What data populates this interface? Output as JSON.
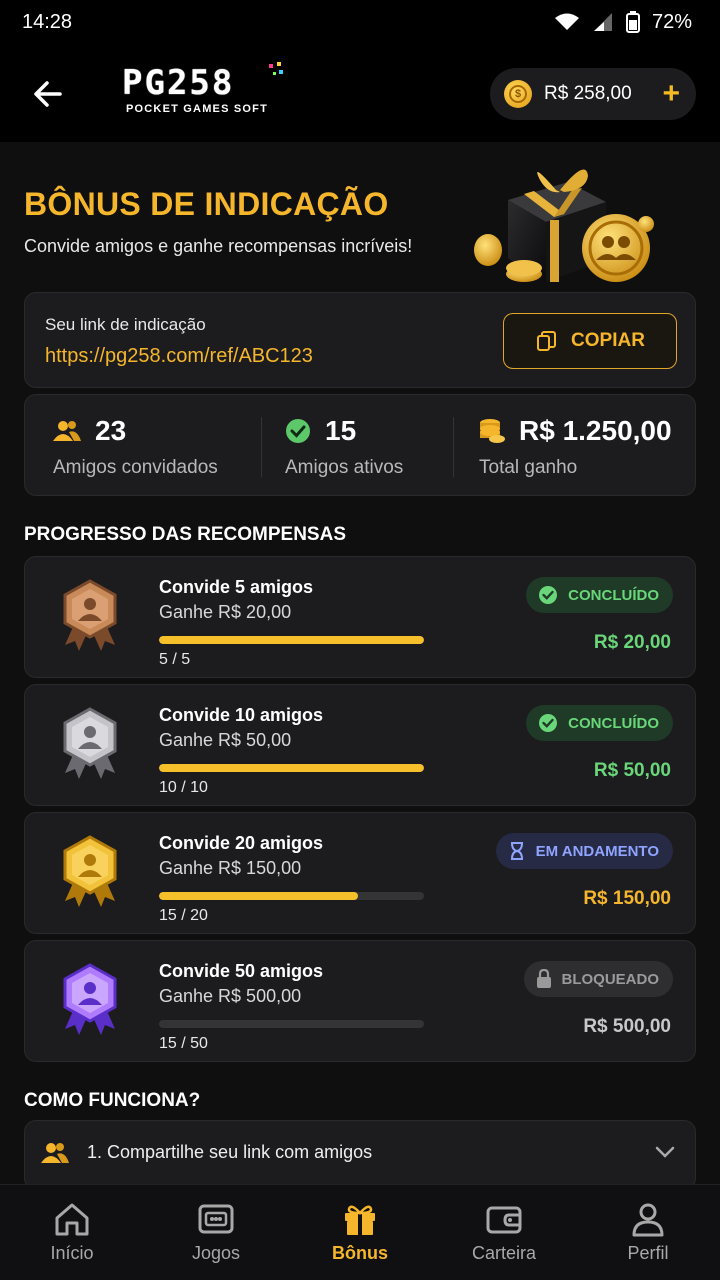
{
  "status_bar": {
    "time": "14:28",
    "battery": "72%"
  },
  "header": {
    "logo_main": "PG258",
    "logo_sub": "POCKET GAMES SOFT",
    "balance": "R$ 258,00"
  },
  "hero": {
    "title": "BÔNUS DE INDICAÇÃO",
    "subtitle": "Convide amigos e ganhe recompensas incríveis!"
  },
  "referral": {
    "label": "Seu link de indicação",
    "url": "https://pg258.com/ref/ABC123",
    "copy_label": "COPIAR"
  },
  "stats": [
    {
      "value": "23",
      "label": "Amigos convidados",
      "icon": "users-icon"
    },
    {
      "value": "15",
      "label": "Amigos ativos",
      "icon": "check-circle-icon"
    },
    {
      "value": "R$ 1.250,00",
      "label": "Total ganho",
      "icon": "coins-icon"
    }
  ],
  "progress_title": "PROGRESSO DAS RECOMPENSAS",
  "rewards": [
    {
      "title": "Convide 5 amigos",
      "subtitle": "Ganhe R$ 20,00",
      "current": 5,
      "target": 5,
      "count": "5 / 5",
      "status": "CONCLUÍDO",
      "amount": "R$ 20,00",
      "tier": "bronze",
      "state": "done",
      "amount_color": "#6ad67a"
    },
    {
      "title": "Convide 10 amigos",
      "subtitle": "Ganhe R$ 50,00",
      "current": 10,
      "target": 10,
      "count": "10 / 10",
      "status": "CONCLUÍDO",
      "amount": "R$ 50,00",
      "tier": "silver",
      "state": "done",
      "amount_color": "#6ad67a"
    },
    {
      "title": "Convide 20 amigos",
      "subtitle": "Ganhe R$ 150,00",
      "current": 15,
      "target": 20,
      "count": "15 / 20",
      "status": "EM ANDAMENTO",
      "amount": "R$ 150,00",
      "tier": "gold",
      "state": "progress",
      "amount_color": "#f5b62c"
    },
    {
      "title": "Convide 50 amigos",
      "subtitle": "Ganhe R$ 500,00",
      "current": 15,
      "target": 50,
      "count": "15 / 50",
      "status": "BLOQUEADO",
      "amount": "R$ 500,00",
      "tier": "purple",
      "state": "locked",
      "amount_color": "#c8c8c8",
      "bar_hidden": true
    }
  ],
  "how_title": "COMO FUNCIONA?",
  "how_items": [
    {
      "text": "1. Compartilhe seu link com amigos"
    }
  ],
  "nav": [
    {
      "label": "Início",
      "icon": "home-icon",
      "active": false
    },
    {
      "label": "Jogos",
      "icon": "gamepad-icon",
      "active": false
    },
    {
      "label": "Bônus",
      "icon": "gift-icon",
      "active": true
    },
    {
      "label": "Carteira",
      "icon": "wallet-icon",
      "active": false
    },
    {
      "label": "Perfil",
      "icon": "profile-icon",
      "active": false
    }
  ],
  "colors": {
    "accent": "#f5b62c",
    "success": "#6ad67a",
    "info": "#8ea4ff",
    "background": "#0f0f10",
    "card": "#1c1c1e"
  }
}
